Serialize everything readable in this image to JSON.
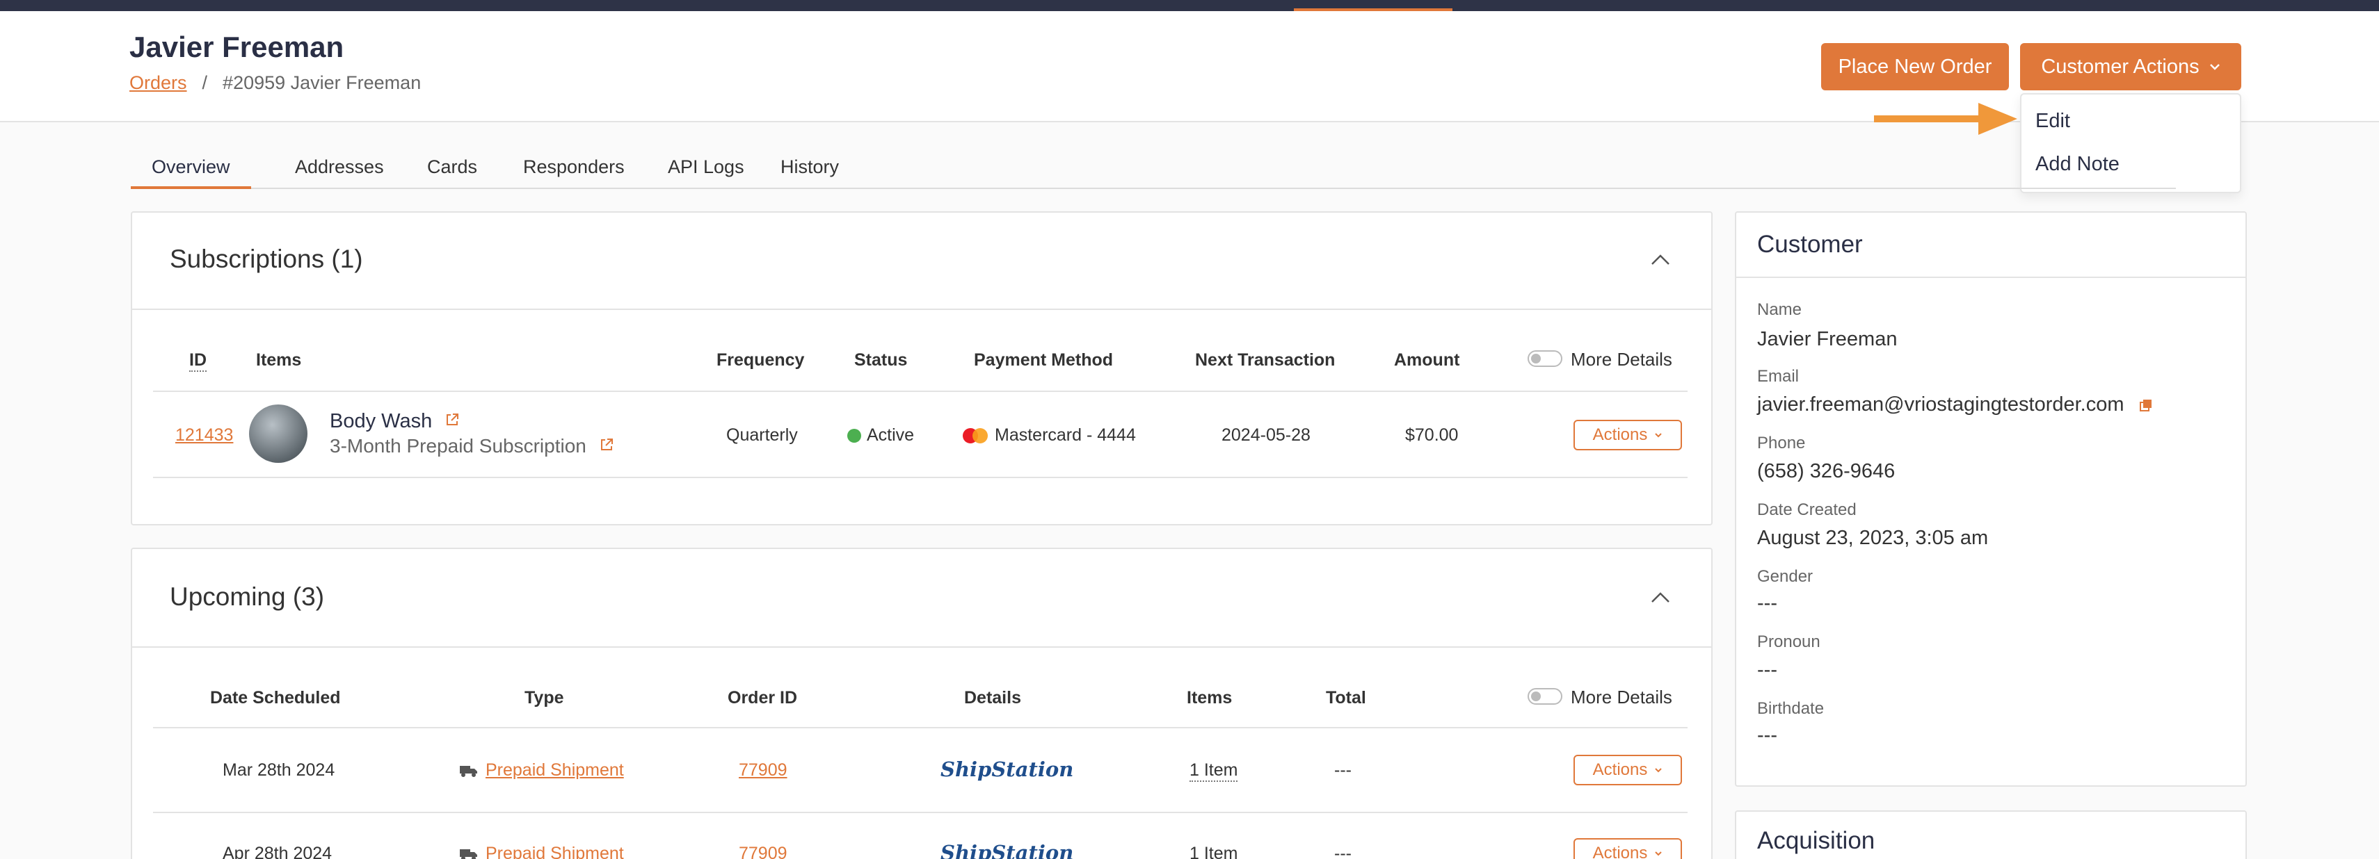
{
  "header": {
    "title": "Javier Freeman",
    "breadcrumb": {
      "root": "Orders",
      "separator": "/",
      "current": "#20959 Javier Freeman"
    },
    "place_order_label": "Place New Order",
    "customer_actions_label": "Customer Actions",
    "dropdown": [
      "Edit",
      "Add Note"
    ]
  },
  "tabs": [
    "Overview",
    "Addresses",
    "Cards",
    "Responders",
    "API Logs",
    "History"
  ],
  "subscriptions": {
    "title": "Subscriptions (1)",
    "headers": {
      "id": "ID",
      "items": "Items",
      "frequency": "Frequency",
      "status": "Status",
      "payment": "Payment Method",
      "next": "Next Transaction",
      "amount": "Amount",
      "more": "More Details"
    },
    "row": {
      "id": "121433",
      "item_name": "Body Wash",
      "item_sub": "3-Month Prepaid Subscription",
      "frequency": "Quarterly",
      "status": "Active",
      "payment": "Mastercard - 4444",
      "next": "2024-05-28",
      "amount": "$70.00",
      "actions": "Actions"
    }
  },
  "upcoming": {
    "title": "Upcoming (3)",
    "headers": {
      "date": "Date Scheduled",
      "type": "Type",
      "order": "Order ID",
      "details": "Details",
      "items": "Items",
      "total": "Total",
      "more": "More Details"
    },
    "rows": [
      {
        "date": "Mar 28th 2024",
        "type": "Prepaid Shipment",
        "order": "77909",
        "details": "ShipStation",
        "items": "1 Item",
        "total": "---",
        "actions": "Actions"
      },
      {
        "date": "Apr 28th 2024",
        "type": "Prepaid Shipment",
        "order": "77909",
        "details": "ShipStation",
        "items": "1 Item",
        "total": "---",
        "actions": "Actions"
      }
    ]
  },
  "customer": {
    "title": "Customer",
    "fields": [
      {
        "label": "Name",
        "value": "Javier Freeman"
      },
      {
        "label": "Email",
        "value": "javier.freeman@vriostagingtestorder.com"
      },
      {
        "label": "Phone",
        "value": "(658) 326-9646"
      },
      {
        "label": "Date Created",
        "value": "August 23, 2023, 3:05 am"
      },
      {
        "label": "Gender",
        "value": "---"
      },
      {
        "label": "Pronoun",
        "value": "---"
      },
      {
        "label": "Birthdate",
        "value": "---"
      }
    ]
  },
  "acquisition": {
    "title": "Acquisition"
  },
  "colors": {
    "accent": "#e0783a",
    "navy": "#2e3347",
    "active": "#4caf50"
  }
}
